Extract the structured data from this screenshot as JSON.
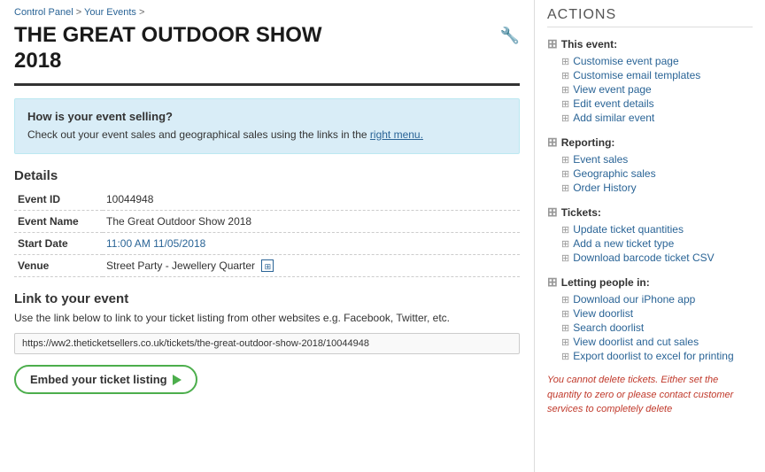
{
  "breadcrumb": {
    "items": [
      "Control Panel",
      "Your Events"
    ],
    "separator": " > "
  },
  "event": {
    "title_line1": "THE GREAT OUTDOOR SHOW",
    "title_line2": "2018"
  },
  "info_box": {
    "title": "How is your event selling?",
    "text_before_link": "Check out your event sales and geographical sales using the links in the",
    "link_text": "right menu.",
    "full_text": "Check out your event sales and geographical sales using the links in the right menu."
  },
  "details": {
    "heading": "Details",
    "rows": [
      {
        "label": "Event ID",
        "value": "10044948"
      },
      {
        "label": "Event Name",
        "value": "The Great Outdoor Show 2018"
      },
      {
        "label": "Start Date",
        "value": "11:00 AM 11/05/2018"
      },
      {
        "label": "Venue",
        "value": "Street Party - Jewellery Quarter"
      }
    ]
  },
  "link_section": {
    "heading": "Link to your event",
    "description": "Use the link below to link to your ticket listing from other websites e.g. Facebook, Twitter, etc.",
    "url": "https://ww2.theticketsellers.co.uk/tickets/the-great-outdoor-show-2018/10044948"
  },
  "embed_button": {
    "label": "Embed your ticket listing"
  },
  "sidebar": {
    "title": "ACTIONS",
    "sections": [
      {
        "title": "This event:",
        "items": [
          {
            "label": "Customise event page",
            "href": "#"
          },
          {
            "label": "Customise email templates",
            "href": "#"
          },
          {
            "label": "View event page",
            "href": "#"
          },
          {
            "label": "Edit event details",
            "href": "#"
          },
          {
            "label": "Add similar event",
            "href": "#"
          }
        ]
      },
      {
        "title": "Reporting:",
        "items": [
          {
            "label": "Event sales",
            "href": "#"
          },
          {
            "label": "Geographic sales",
            "href": "#"
          },
          {
            "label": "Order History",
            "href": "#"
          }
        ]
      },
      {
        "title": "Tickets:",
        "items": [
          {
            "label": "Update ticket quantities",
            "href": "#"
          },
          {
            "label": "Add a new ticket type",
            "href": "#"
          },
          {
            "label": "Download barcode ticket CSV",
            "href": "#"
          }
        ]
      },
      {
        "title": "Letting people in:",
        "items": [
          {
            "label": "Download our iPhone app",
            "href": "#"
          },
          {
            "label": "View doorlist",
            "href": "#"
          },
          {
            "label": "Search doorlist",
            "href": "#"
          },
          {
            "label": "View doorlist and cut sales",
            "href": "#"
          },
          {
            "label": "Export doorlist to excel for printing",
            "href": "#"
          }
        ]
      }
    ],
    "delete_note": "You cannot delete tickets. Either set the quantity to zero or please contact customer services to completely delete"
  }
}
